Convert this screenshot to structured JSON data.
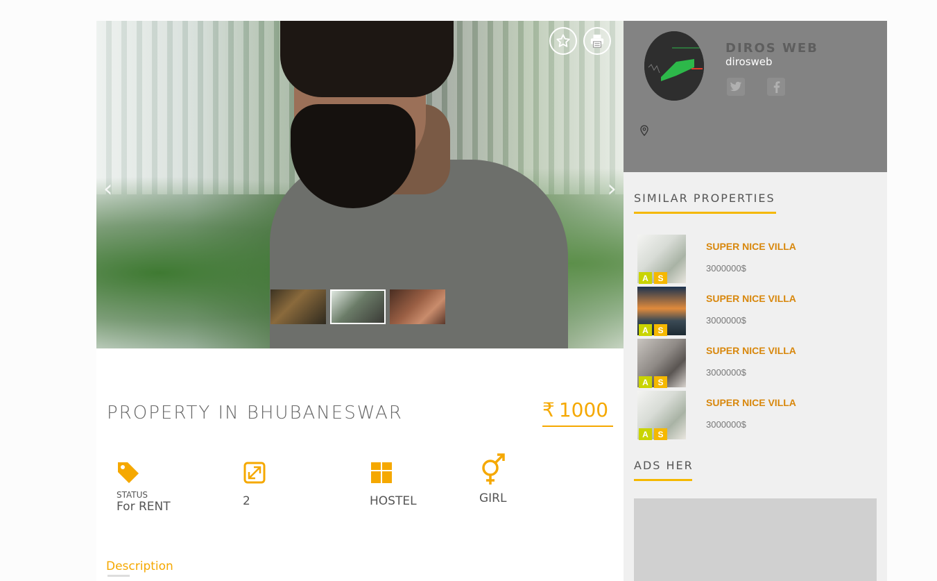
{
  "listing": {
    "title": "PROPERTY IN BHUBANESWAR",
    "currency_symbol": "₹",
    "price": "1000",
    "features": {
      "status_label": "STATUS",
      "status_value": "For RENT",
      "size_value": "2",
      "type_value": "HOSTEL",
      "gender_value": "GIRL"
    },
    "tabs": {
      "description": "Description"
    }
  },
  "gallery": {
    "thumbnails": [
      "thumb-1",
      "thumb-2",
      "thumb-3"
    ],
    "active_index": 1
  },
  "agent": {
    "name": "DIROS WEB",
    "handle": "dirosweb",
    "social": [
      "twitter-icon",
      "facebook-icon"
    ]
  },
  "sidebar": {
    "similar_title": "SIMILAR PROPERTIES",
    "similar": [
      {
        "name": "SUPER NICE VILLA",
        "price": "3000000$",
        "badge_a": "A",
        "badge_s": "S"
      },
      {
        "name": "SUPER NICE VILLA",
        "price": "3000000$",
        "badge_a": "A",
        "badge_s": "S"
      },
      {
        "name": "SUPER NICE VILLA",
        "price": "3000000$",
        "badge_a": "A",
        "badge_s": "S"
      },
      {
        "name": "SUPER NICE VILLA",
        "price": "3000000$",
        "badge_a": "A",
        "badge_s": "S"
      }
    ],
    "ads_title": "ADS HER"
  },
  "colors": {
    "accent": "#f5a800",
    "link": "#d8870c",
    "agent_panel": "#838383",
    "sidebar_bg": "#f0f0f0"
  }
}
